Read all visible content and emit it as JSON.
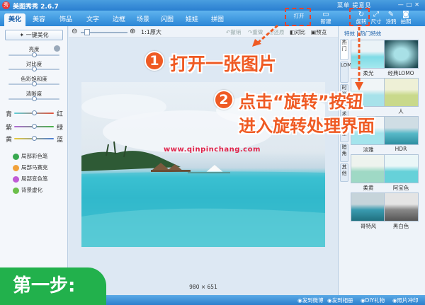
{
  "app": {
    "title": "美图秀秀 2.6.7",
    "links": "菜单 提意见",
    "logo_glyph": "秀"
  },
  "menu": {
    "tabs": [
      "美化",
      "美容",
      "饰品",
      "文字",
      "边框",
      "场景",
      "闪图",
      "娃娃",
      "拼图"
    ],
    "active_tab": "美化",
    "toolbar": [
      {
        "label": "打开",
        "icon": "folder-open-icon"
      },
      {
        "label": "新建",
        "icon": "new-file-icon"
      },
      {
        "label": "旋转",
        "icon": "rotate-icon"
      },
      {
        "label": "尺寸",
        "icon": "resize-icon"
      },
      {
        "label": "涂鸦",
        "icon": "brush-icon"
      },
      {
        "label": "拍照",
        "icon": "camera-icon"
      }
    ]
  },
  "left": {
    "auto_button": "一键美化",
    "sliders": [
      {
        "label": "亮度",
        "value": 0.5
      },
      {
        "label": "对比度",
        "value": 0.5
      },
      {
        "label": "色彩饱和度",
        "value": 0.5
      },
      {
        "label": "清晰度",
        "value": 0.5
      }
    ],
    "color_sliders": [
      {
        "left": "青",
        "right": "红",
        "value": 0.5,
        "color": "#e4553e"
      },
      {
        "left": "紫",
        "right": "绿",
        "value": 0.5,
        "color": "#48b548"
      },
      {
        "left": "黄",
        "right": "蓝",
        "value": 0.5,
        "color": "#4a7ed8"
      }
    ],
    "tools": [
      {
        "label": "局部彩色笔",
        "color": "#37a84f"
      },
      {
        "label": "局部马赛克",
        "color": "#f1a13a"
      },
      {
        "label": "局部变色笔",
        "color": "#c05bd6"
      },
      {
        "label": "背景虚化",
        "color": "#6cbf4a"
      }
    ]
  },
  "canvas_toolbar": {
    "zoom_label": "1:1原大",
    "actions": [
      "撤销",
      "重做",
      "还原",
      "对比",
      "预览"
    ]
  },
  "image": {
    "watermark": "www.qinpinchang.com",
    "dimensions": "980 × 651"
  },
  "right": {
    "header": "特效 | 热门特效",
    "vertical_tabs": [
      "热门",
      "LOMO",
      "时尚",
      "艺术",
      "影楼",
      "暗角",
      "其他"
    ],
    "effects": [
      {
        "label": "柔光",
        "tone": "#7fdbe6"
      },
      {
        "label": "经典LOMO",
        "tone": "#3d9aa8"
      },
      {
        "label": "人",
        "tone": "#a7e2ea"
      },
      {
        "label": "",
        "tone": "#c9d98b"
      },
      {
        "label": "淡雅",
        "tone": "#a4e4ec"
      },
      {
        "label": "HDR",
        "tone": "#58b9c8"
      },
      {
        "label": "柔黄",
        "tone": "#9fd9c5"
      },
      {
        "label": "阿宝色",
        "tone": "#66d1d9"
      },
      {
        "label": "哥特风",
        "tone": "#3a9bb0"
      },
      {
        "label": "黑白色",
        "tone": "#888888"
      }
    ]
  },
  "status": {
    "items": [
      "发到微博",
      "发到相册",
      "DIY礼物",
      "照片冲印"
    ]
  },
  "annotations": {
    "step1_num": "1",
    "step1_text": "打开一张图片",
    "step2_num": "2",
    "step2_line1": "点击“旋转”按钮",
    "step2_line2": "进入旋转处理界面",
    "step_badge": "第一步:",
    "accent": "#ef5a23"
  }
}
